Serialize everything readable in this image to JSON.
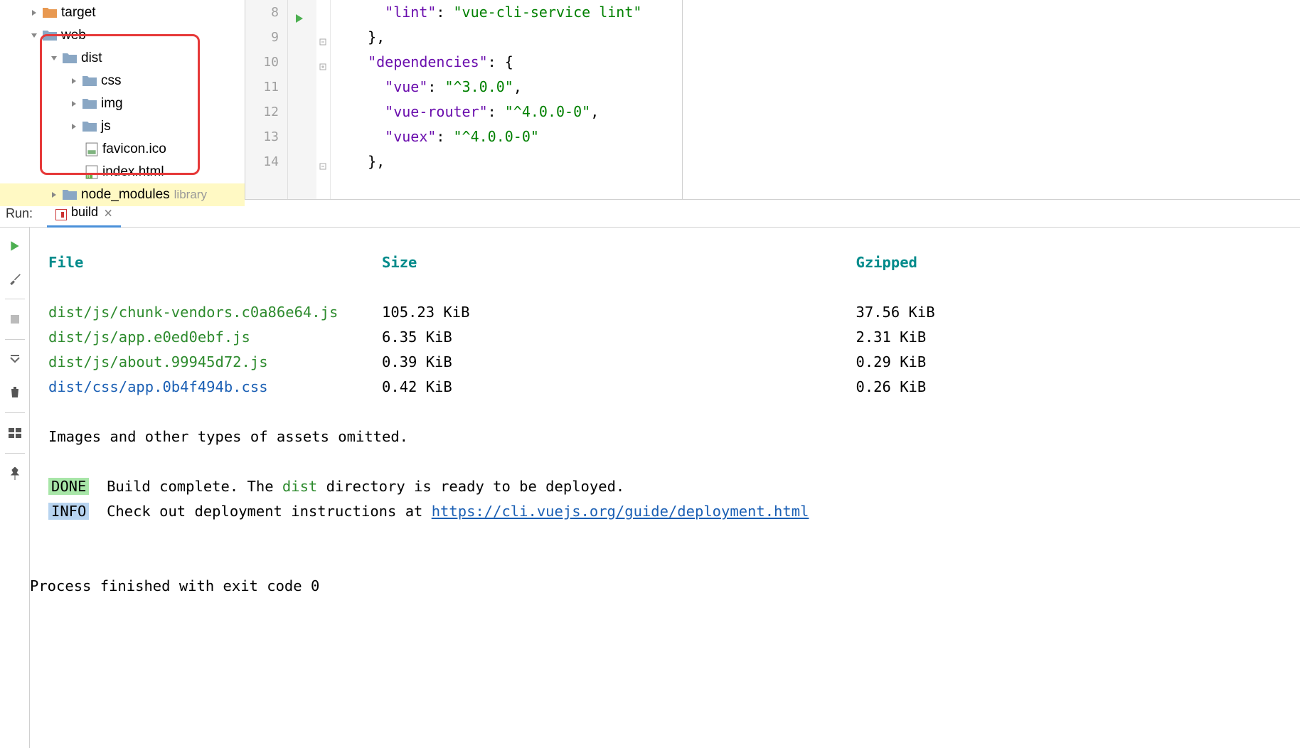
{
  "sidebar": {
    "target": "target",
    "web": "web",
    "dist": "dist",
    "css": "css",
    "img": "img",
    "js": "js",
    "favicon": "favicon.ico",
    "index": "index.html",
    "node_modules": "node_modules",
    "library_root": "library"
  },
  "editor": {
    "line_numbers": [
      "8",
      "9",
      "10",
      "11",
      "12",
      "13",
      "14"
    ],
    "lines": {
      "l8_key": "\"lint\"",
      "l8_val": "\"vue-cli-service lint\"",
      "l9": "},",
      "l10_key": "\"dependencies\"",
      "l10_rest": ": {",
      "l11_key": "\"vue\"",
      "l11_val": "\"^3.0.0\"",
      "l12_key": "\"vue-router\"",
      "l12_val": "\"^4.0.0-0\"",
      "l13_key": "\"vuex\"",
      "l13_val": "\"^4.0.0-0\"",
      "l14": "},"
    }
  },
  "run": {
    "label": "Run:",
    "tab": "build",
    "headers": {
      "file": "File",
      "size": "Size",
      "gzipped": "Gzipped"
    },
    "rows": [
      {
        "file": "dist/js/chunk-vendors.c0a86e64.js",
        "size": "105.23 KiB",
        "gzipped": "37.56 KiB",
        "cls": "file-green"
      },
      {
        "file": "dist/js/app.e0ed0ebf.js",
        "size": "6.35 KiB",
        "gzipped": "2.31 KiB",
        "cls": "file-green"
      },
      {
        "file": "dist/js/about.99945d72.js",
        "size": "0.39 KiB",
        "gzipped": "0.29 KiB",
        "cls": "file-green"
      },
      {
        "file": "dist/css/app.0b4f494b.css",
        "size": "0.42 KiB",
        "gzipped": "0.26 KiB",
        "cls": "file-blue"
      }
    ],
    "omitted": "Images and other types of assets omitted.",
    "done_badge": "DONE",
    "done_text": "Build complete. The ",
    "done_dist": "dist",
    "done_text2": " directory is ready to be deployed.",
    "info_badge": "INFO",
    "info_text": "Check out deployment instructions at ",
    "info_link": "https://cli.vuejs.org/guide/deployment.html",
    "exit": "Process finished with exit code 0"
  }
}
